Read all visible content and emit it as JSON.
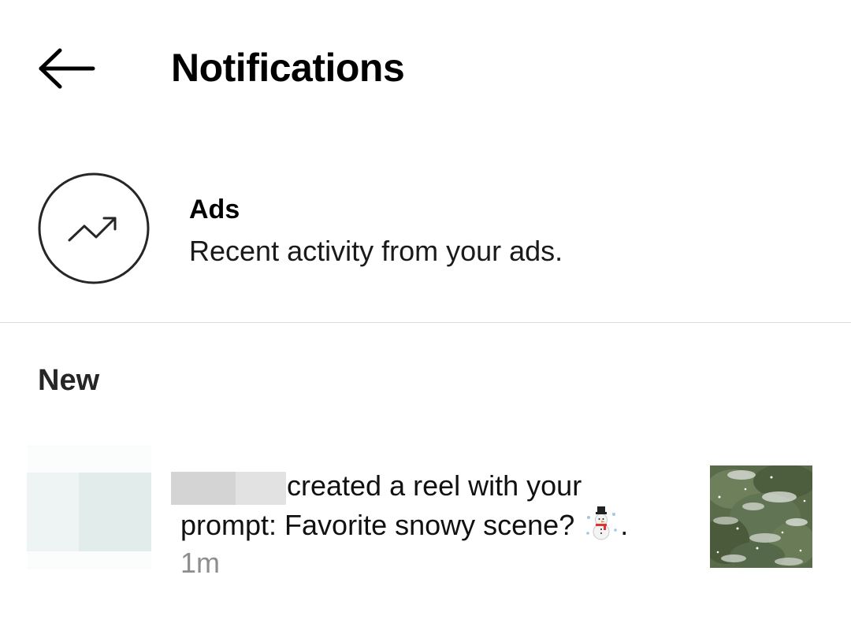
{
  "header": {
    "back_icon": "arrow-left-icon",
    "title": "Notifications"
  },
  "ads": {
    "icon": "trending-up-icon",
    "title": "Ads",
    "subtitle": "Recent activity from your ads."
  },
  "sections": {
    "new_label": "New"
  },
  "notifications": [
    {
      "text_line1": "created a reel with your",
      "text_line2_prefix": "prompt: Favorite snowy scene?",
      "emoji": "snowman-icon",
      "text_line2_suffix": ".",
      "time": "1m",
      "thumbnail": "snowy-trees-thumbnail"
    }
  ],
  "colors": {
    "text_primary": "#000000",
    "text_secondary": "#8e8e8e",
    "divider": "#dbdbdb"
  }
}
